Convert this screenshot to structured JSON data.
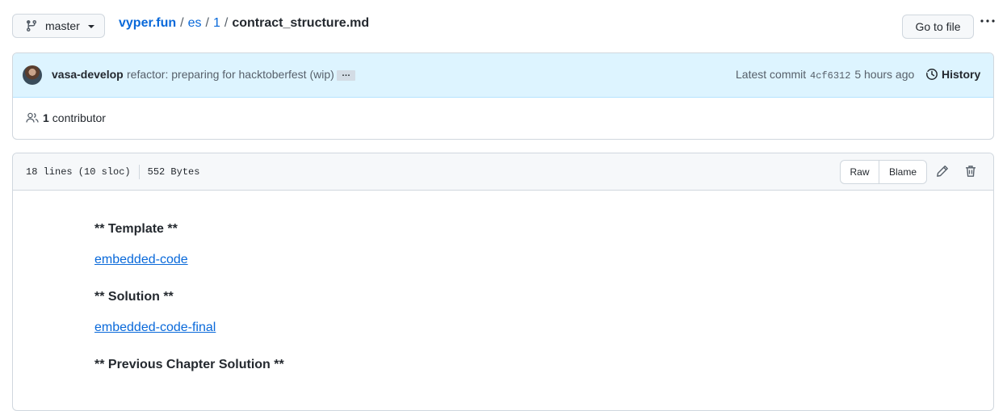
{
  "branch": {
    "label": "master",
    "icon": "git-branch-icon"
  },
  "breadcrumb": {
    "root": "vyper.fun",
    "parts": [
      "es",
      "1"
    ],
    "separator": "/",
    "file": "contract_structure.md"
  },
  "goto_file": "Go to file",
  "commit": {
    "author": "vasa-develop",
    "message": "refactor: preparing for hacktoberfest (wip)",
    "ellipsis": "…",
    "latest_label": "Latest commit",
    "sha": "4cf6312",
    "time": "5 hours ago",
    "history_label": "History"
  },
  "contributors": {
    "count": "1",
    "label": "contributor"
  },
  "file": {
    "lines": "18 lines (10 sloc)",
    "size": "552 Bytes",
    "raw_label": "Raw",
    "blame_label": "Blame"
  },
  "content": {
    "heading1": "** Template **",
    "link1": "embedded-code",
    "heading2": "** Solution **",
    "link2": "embedded-code-final",
    "heading3": "** Previous Chapter Solution **"
  },
  "colors": {
    "link": "#0969da",
    "commit_bg": "#ddf4ff",
    "border": "#d0d7de"
  }
}
